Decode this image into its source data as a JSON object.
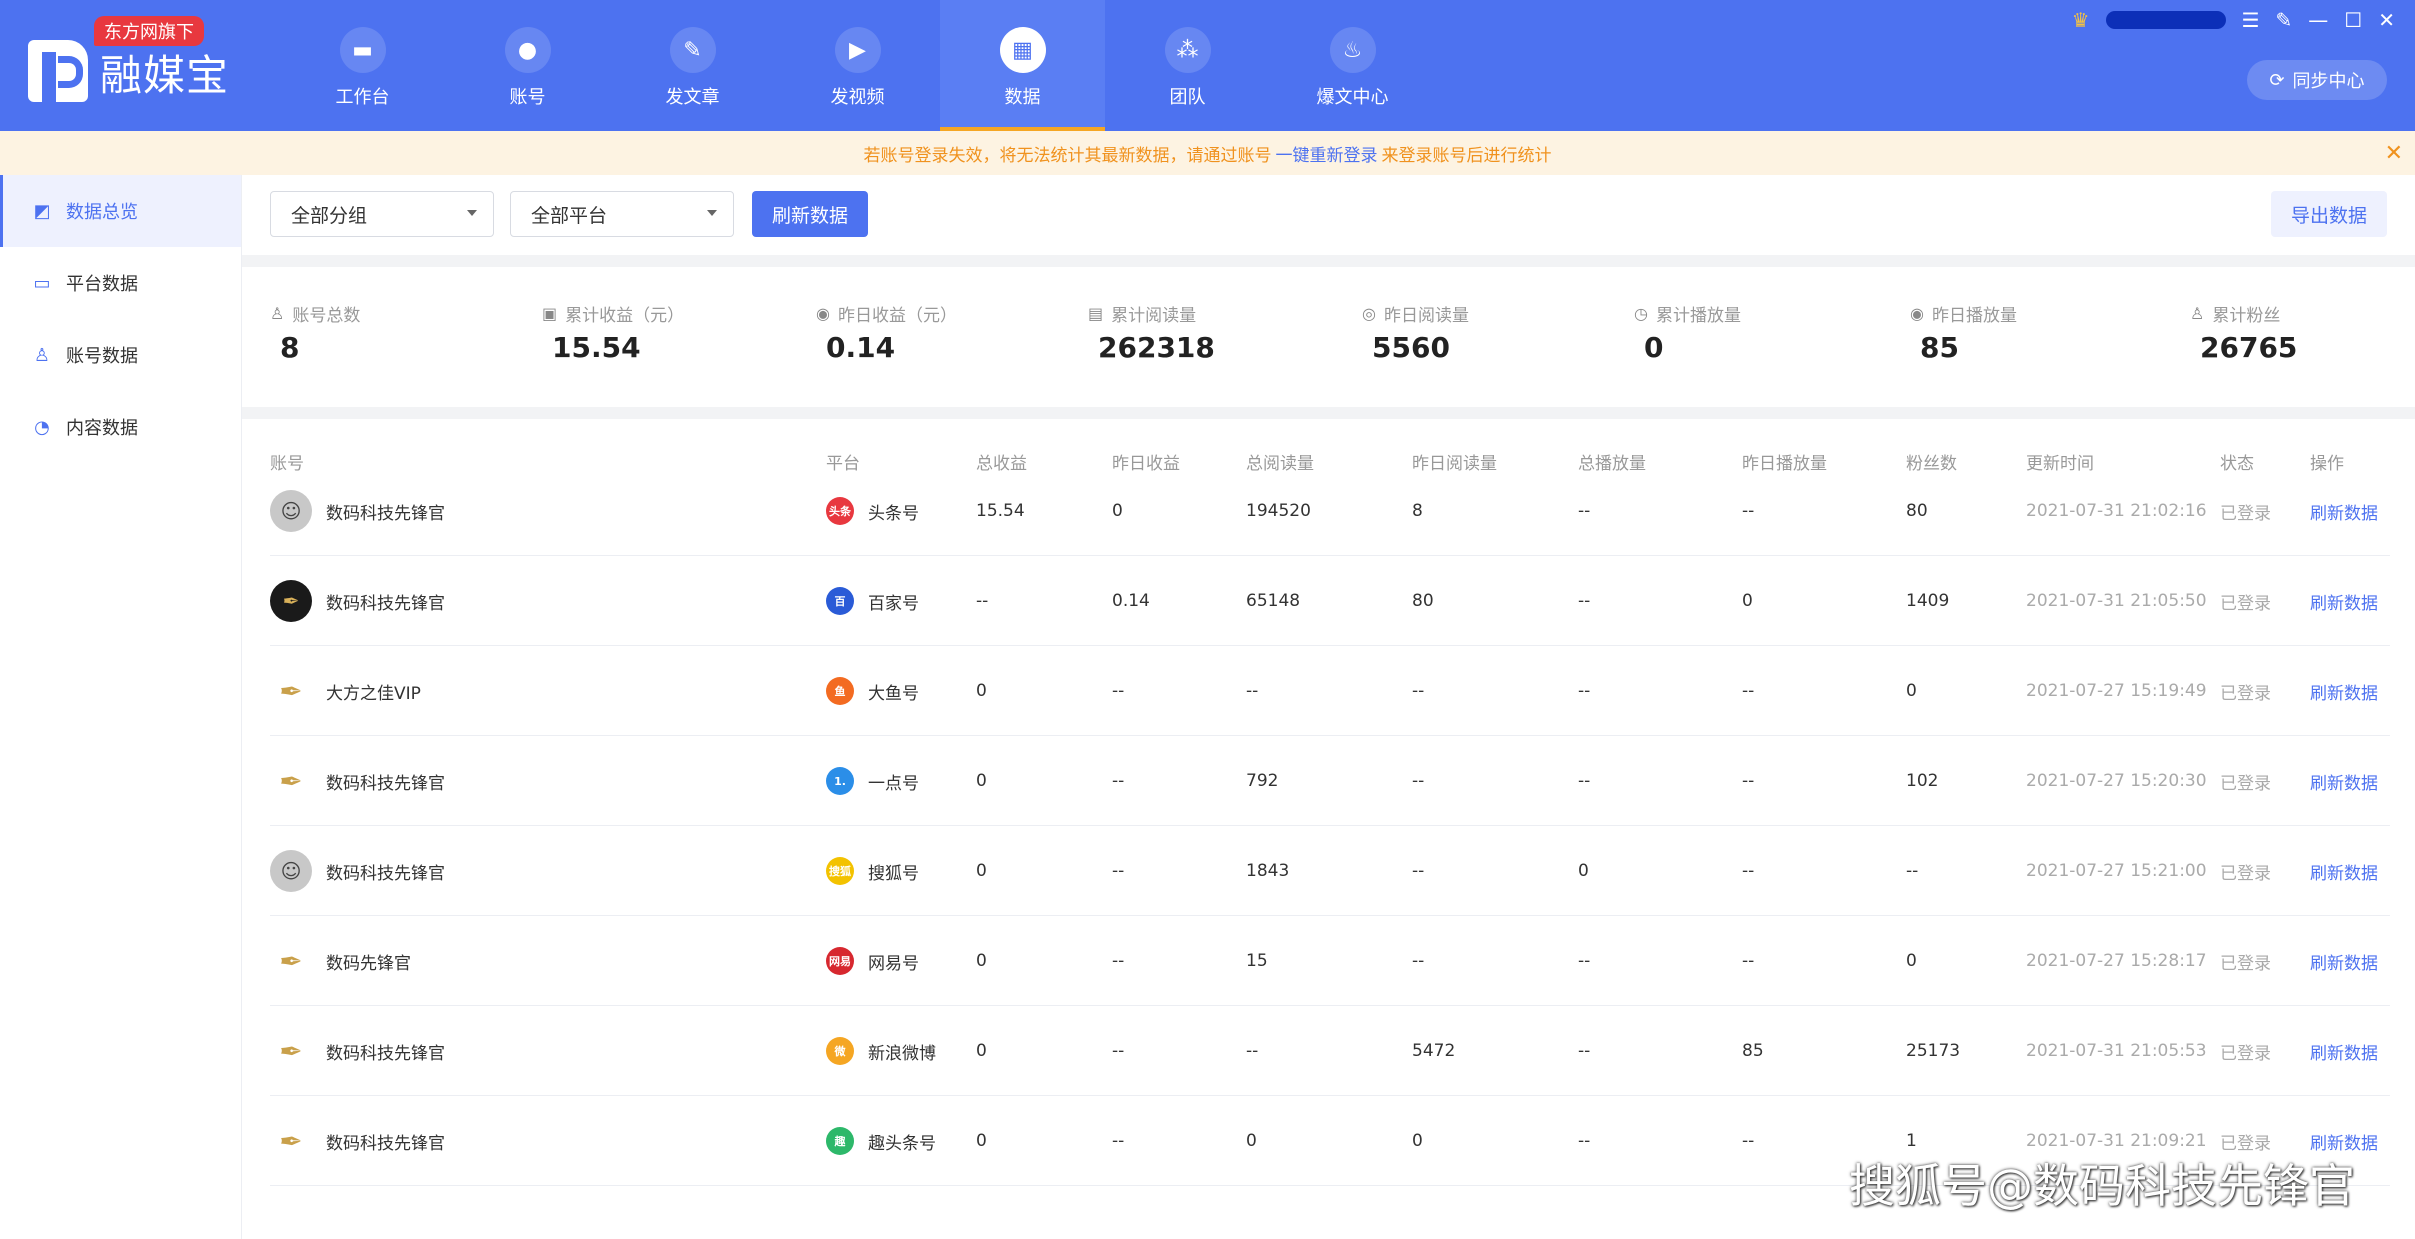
{
  "app": {
    "name": "融媒宝",
    "badge": "东方网旗下"
  },
  "nav": [
    {
      "label": "工作台",
      "icon": "monitor-icon",
      "glyph": "▬",
      "active": false
    },
    {
      "label": "账号",
      "icon": "user-icon",
      "glyph": "●",
      "active": false
    },
    {
      "label": "发文章",
      "icon": "feather-icon",
      "glyph": "✎",
      "active": false
    },
    {
      "label": "发视频",
      "icon": "video-icon",
      "glyph": "▶",
      "active": false
    },
    {
      "label": "数据",
      "icon": "chart-icon",
      "glyph": "▦",
      "active": true
    },
    {
      "label": "团队",
      "icon": "team-icon",
      "glyph": "⁂",
      "active": false
    },
    {
      "label": "爆文中心",
      "icon": "fire-icon",
      "glyph": "♨",
      "active": false
    }
  ],
  "window": {
    "sync_label": "同步中心",
    "menu_glyph": "☰",
    "edit_glyph": "✎",
    "min_glyph": "—",
    "max_glyph": "☐",
    "close_glyph": "✕"
  },
  "notice": {
    "prefix": "若账号登录失效，将无法统计其最新数据，请通过账号",
    "link": "一键重新登录",
    "suffix": "来登录账号后进行统计",
    "close_glyph": "✕"
  },
  "sidebar": [
    {
      "label": "数据总览",
      "icon": "overview-icon",
      "glyph": "◩",
      "active": true
    },
    {
      "label": "平台数据",
      "icon": "platform-icon",
      "glyph": "▭",
      "active": false
    },
    {
      "label": "账号数据",
      "icon": "account-icon",
      "glyph": "♙",
      "active": false
    },
    {
      "label": "内容数据",
      "icon": "pie-icon",
      "glyph": "◔",
      "active": false
    }
  ],
  "toolbar": {
    "group_select": "全部分组",
    "platform_select": "全部平台",
    "refresh_label": "刷新数据",
    "export_label": "导出数据"
  },
  "stats": [
    {
      "label": "账号总数",
      "value": "8",
      "glyph": "♙"
    },
    {
      "label": "累计收益（元）",
      "value": "15.54",
      "glyph": "▣"
    },
    {
      "label": "昨日收益（元）",
      "value": "0.14",
      "glyph": "◉"
    },
    {
      "label": "累计阅读量",
      "value": "262318",
      "glyph": "▤"
    },
    {
      "label": "昨日阅读量",
      "value": "5560",
      "glyph": "◎"
    },
    {
      "label": "累计播放量",
      "value": "0",
      "glyph": "◷"
    },
    {
      "label": "昨日播放量",
      "value": "85",
      "glyph": "◉"
    },
    {
      "label": "累计粉丝",
      "value": "26765",
      "glyph": "♙"
    }
  ],
  "table": {
    "headers": [
      "账号",
      "平台",
      "总收益",
      "昨日收益",
      "总阅读量",
      "昨日阅读量",
      "总播放量",
      "昨日播放量",
      "粉丝数",
      "更新时间",
      "状态",
      "操作"
    ],
    "rows": [
      {
        "account": "数码科技先锋官",
        "avatar": "photo",
        "avatar_glyph": "☺",
        "platform": "头条号",
        "plat_color": "#e8383f",
        "plat_glyph": "头条",
        "total_income": "15.54",
        "yday_income": "0",
        "total_read": "194520",
        "yday_read": "8",
        "total_play": "--",
        "yday_play": "--",
        "fans": "80",
        "updated": "2021-07-31 21:02:16",
        "status": "已登录",
        "action": "刷新数据"
      },
      {
        "account": "数码科技先锋官",
        "avatar": "dark",
        "avatar_glyph": "✒",
        "platform": "百家号",
        "plat_color": "#2a5bd7",
        "plat_glyph": "百",
        "total_income": "--",
        "yday_income": "0.14",
        "total_read": "65148",
        "yday_read": "80",
        "total_play": "--",
        "yday_play": "0",
        "fans": "1409",
        "updated": "2021-07-31 21:05:50",
        "status": "已登录",
        "action": "刷新数据"
      },
      {
        "account": "大方之佳VIP",
        "avatar": "gold",
        "avatar_glyph": "✒",
        "platform": "大鱼号",
        "plat_color": "#f36b21",
        "plat_glyph": "鱼",
        "total_income": "0",
        "yday_income": "--",
        "total_read": "--",
        "yday_read": "--",
        "total_play": "--",
        "yday_play": "--",
        "fans": "0",
        "updated": "2021-07-27 15:19:49",
        "status": "已登录",
        "action": "刷新数据"
      },
      {
        "account": "数码科技先锋官",
        "avatar": "gold",
        "avatar_glyph": "✒",
        "platform": "一点号",
        "plat_color": "#2b8ee8",
        "plat_glyph": "1.",
        "total_income": "0",
        "yday_income": "--",
        "total_read": "792",
        "yday_read": "--",
        "total_play": "--",
        "yday_play": "--",
        "fans": "102",
        "updated": "2021-07-27 15:20:30",
        "status": "已登录",
        "action": "刷新数据"
      },
      {
        "account": "数码科技先锋官",
        "avatar": "photo",
        "avatar_glyph": "☺",
        "platform": "搜狐号",
        "plat_color": "#f3c200",
        "plat_glyph": "搜狐",
        "total_income": "0",
        "yday_income": "--",
        "total_read": "1843",
        "yday_read": "--",
        "total_play": "0",
        "yday_play": "--",
        "fans": "--",
        "updated": "2021-07-27 15:21:00",
        "status": "已登录",
        "action": "刷新数据"
      },
      {
        "account": "数码先锋官",
        "avatar": "gold",
        "avatar_glyph": "✒",
        "platform": "网易号",
        "plat_color": "#d7282f",
        "plat_glyph": "网易",
        "total_income": "0",
        "yday_income": "--",
        "total_read": "15",
        "yday_read": "--",
        "total_play": "--",
        "yday_play": "--",
        "fans": "0",
        "updated": "2021-07-27 15:28:17",
        "status": "已登录",
        "action": "刷新数据"
      },
      {
        "account": "数码科技先锋官",
        "avatar": "gold",
        "avatar_glyph": "✒",
        "platform": "新浪微博",
        "plat_color": "#f5a623",
        "plat_glyph": "微",
        "total_income": "0",
        "yday_income": "--",
        "total_read": "--",
        "yday_read": "5472",
        "total_play": "--",
        "yday_play": "85",
        "fans": "25173",
        "updated": "2021-07-31 21:05:53",
        "status": "已登录",
        "action": "刷新数据"
      },
      {
        "account": "数码科技先锋官",
        "avatar": "gold",
        "avatar_glyph": "✒",
        "platform": "趣头条号",
        "plat_color": "#2db86a",
        "plat_glyph": "趣",
        "total_income": "0",
        "yday_income": "--",
        "total_read": "0",
        "yday_read": "0",
        "total_play": "--",
        "yday_play": "--",
        "fans": "1",
        "updated": "2021-07-31 21:09:21",
        "status": "已登录",
        "action": "刷新数据"
      }
    ]
  },
  "watermark": "搜狐号@数码科技先锋官"
}
